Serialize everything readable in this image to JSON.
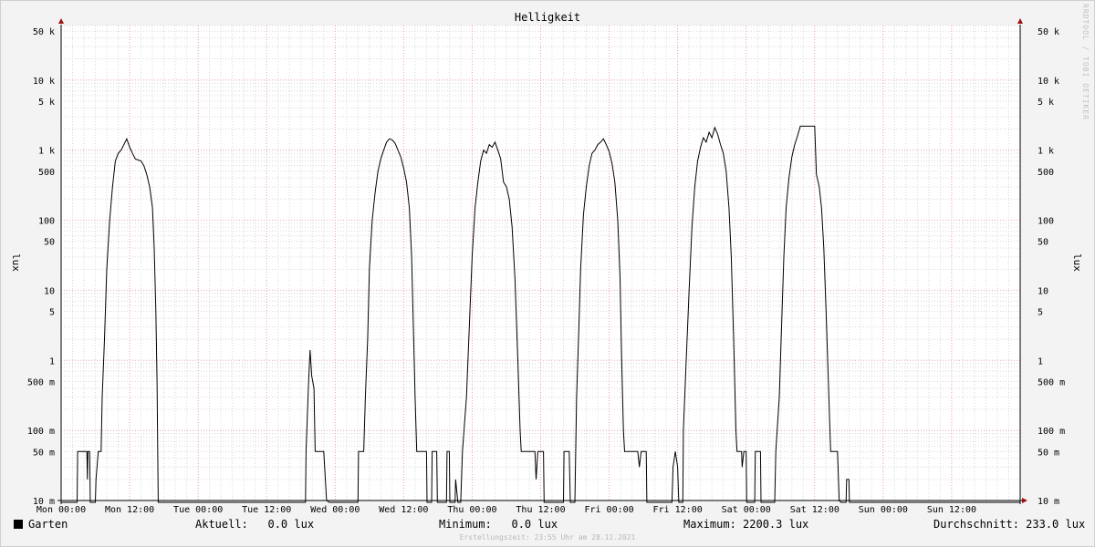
{
  "chart_data": {
    "type": "line",
    "title": "Helligkeit",
    "ylabel_left": "lux",
    "ylabel_right": "lux",
    "yscale": "log",
    "ylim": [
      10,
      60000
    ],
    "x_tick_labels": [
      "Mon 00:00",
      "Mon 12:00",
      "Tue 00:00",
      "Tue 12:00",
      "Wed 00:00",
      "Wed 12:00",
      "Thu 00:00",
      "Thu 12:00",
      "Fri 00:00",
      "Fri 12:00",
      "Sat 00:00",
      "Sat 12:00",
      "Sun 00:00",
      "Sun 12:00"
    ],
    "x_hours_range": [
      0,
      168
    ],
    "y_ticks": [
      {
        "value": 50000,
        "label": "50 k"
      },
      {
        "value": 10000,
        "label": "10 k"
      },
      {
        "value": 5000,
        "label": "5 k"
      },
      {
        "value": 1000,
        "label": "1 k"
      },
      {
        "value": 500,
        "label": "500"
      },
      {
        "value": 100,
        "label": "100"
      },
      {
        "value": 50,
        "label": "50"
      },
      {
        "value": 10,
        "label": "10"
      },
      {
        "value": 5,
        "label": "5"
      },
      {
        "value": 1,
        "label": "1"
      },
      {
        "value": 0.5,
        "label": "500 m"
      },
      {
        "value": 0.1,
        "label": "100 m"
      },
      {
        "value": 0.05,
        "label": "50 m"
      },
      {
        "value": 0.01,
        "label": "10 m"
      }
    ],
    "grid": true,
    "series": [
      {
        "name": "Garten",
        "points": [
          [
            0,
            0.001
          ],
          [
            2.8,
            0.001
          ],
          [
            2.9,
            0.05
          ],
          [
            4.5,
            0.05
          ],
          [
            4.6,
            0.02
          ],
          [
            4.7,
            0.05
          ],
          [
            5.0,
            0.05
          ],
          [
            5.1,
            0.001
          ],
          [
            6.0,
            0.001
          ],
          [
            6.1,
            0.02
          ],
          [
            6.5,
            0.05
          ],
          [
            7.0,
            0.05
          ],
          [
            7.2,
            0.3
          ],
          [
            7.6,
            2
          ],
          [
            8.0,
            20
          ],
          [
            8.5,
            100
          ],
          [
            9.0,
            300
          ],
          [
            9.5,
            700
          ],
          [
            10.0,
            900
          ],
          [
            10.5,
            1000
          ],
          [
            11.0,
            1200
          ],
          [
            11.5,
            1450
          ],
          [
            12.0,
            1100
          ],
          [
            12.5,
            900
          ],
          [
            13.0,
            750
          ],
          [
            14.0,
            700
          ],
          [
            14.5,
            600
          ],
          [
            15.0,
            450
          ],
          [
            15.5,
            300
          ],
          [
            16.0,
            150
          ],
          [
            16.3,
            40
          ],
          [
            16.6,
            5
          ],
          [
            16.8,
            0.5
          ],
          [
            17.0,
            0.001
          ],
          [
            42.8,
            0.001
          ],
          [
            42.9,
            0.05
          ],
          [
            43.3,
            0.4
          ],
          [
            43.6,
            1.4
          ],
          [
            43.9,
            0.6
          ],
          [
            44.3,
            0.4
          ],
          [
            44.5,
            0.05
          ],
          [
            46.0,
            0.05
          ],
          [
            46.5,
            0.01
          ],
          [
            47.0,
            0.001
          ],
          [
            52.0,
            0.001
          ],
          [
            52.1,
            0.05
          ],
          [
            53.0,
            0.05
          ],
          [
            53.3,
            0.3
          ],
          [
            53.7,
            2
          ],
          [
            54.0,
            20
          ],
          [
            54.5,
            100
          ],
          [
            55.0,
            250
          ],
          [
            55.5,
            500
          ],
          [
            56.0,
            750
          ],
          [
            56.5,
            1000
          ],
          [
            57.0,
            1300
          ],
          [
            57.5,
            1450
          ],
          [
            58.0,
            1400
          ],
          [
            58.5,
            1250
          ],
          [
            59.0,
            1000
          ],
          [
            59.5,
            800
          ],
          [
            60.0,
            550
          ],
          [
            60.5,
            350
          ],
          [
            61.0,
            150
          ],
          [
            61.4,
            30
          ],
          [
            61.7,
            3
          ],
          [
            62.0,
            0.3
          ],
          [
            62.3,
            0.05
          ],
          [
            64.0,
            0.05
          ],
          [
            64.1,
            0.001
          ],
          [
            64.9,
            0.001
          ],
          [
            65.0,
            0.05
          ],
          [
            65.8,
            0.05
          ],
          [
            65.9,
            0.001
          ],
          [
            67.5,
            0.001
          ],
          [
            67.6,
            0.05
          ],
          [
            68.0,
            0.05
          ],
          [
            68.1,
            0.001
          ],
          [
            69.0,
            0.001
          ],
          [
            69.1,
            0.02
          ],
          [
            69.5,
            0.001
          ],
          [
            70.0,
            0.001
          ],
          [
            70.3,
            0.05
          ],
          [
            71.0,
            0.3
          ],
          [
            71.5,
            3
          ],
          [
            72.0,
            30
          ],
          [
            72.5,
            150
          ],
          [
            73.0,
            350
          ],
          [
            73.5,
            700
          ],
          [
            74.0,
            1000
          ],
          [
            74.5,
            900
          ],
          [
            75.0,
            1200
          ],
          [
            75.5,
            1100
          ],
          [
            76.0,
            1300
          ],
          [
            76.5,
            1000
          ],
          [
            77.0,
            750
          ],
          [
            77.5,
            350
          ],
          [
            78.0,
            300
          ],
          [
            78.5,
            200
          ],
          [
            79.0,
            80
          ],
          [
            79.5,
            15
          ],
          [
            80.0,
            1
          ],
          [
            80.4,
            0.1
          ],
          [
            80.6,
            0.05
          ],
          [
            83.0,
            0.05
          ],
          [
            83.2,
            0.02
          ],
          [
            83.5,
            0.05
          ],
          [
            84.5,
            0.05
          ],
          [
            84.6,
            0.001
          ],
          [
            88.0,
            0.001
          ],
          [
            88.1,
            0.05
          ],
          [
            89.0,
            0.05
          ],
          [
            89.2,
            0.001
          ],
          [
            90.0,
            0.001
          ],
          [
            90.3,
            0.3
          ],
          [
            90.7,
            3
          ],
          [
            91.0,
            20
          ],
          [
            91.5,
            120
          ],
          [
            92.0,
            300
          ],
          [
            92.5,
            600
          ],
          [
            93.0,
            900
          ],
          [
            93.5,
            1000
          ],
          [
            94.0,
            1200
          ],
          [
            94.5,
            1300
          ],
          [
            95.0,
            1450
          ],
          [
            95.5,
            1200
          ],
          [
            96.0,
            950
          ],
          [
            96.5,
            650
          ],
          [
            97.0,
            350
          ],
          [
            97.5,
            100
          ],
          [
            97.9,
            15
          ],
          [
            98.2,
            1
          ],
          [
            98.5,
            0.1
          ],
          [
            98.7,
            0.05
          ],
          [
            101.0,
            0.05
          ],
          [
            101.3,
            0.03
          ],
          [
            101.6,
            0.05
          ],
          [
            102.5,
            0.05
          ],
          [
            102.6,
            0.001
          ],
          [
            107.0,
            0.001
          ],
          [
            107.2,
            0.03
          ],
          [
            107.6,
            0.05
          ],
          [
            108.0,
            0.03
          ],
          [
            108.2,
            0.001
          ],
          [
            108.9,
            0.001
          ],
          [
            109.0,
            0.1
          ],
          [
            109.5,
            1
          ],
          [
            110.0,
            10
          ],
          [
            110.5,
            80
          ],
          [
            111.0,
            300
          ],
          [
            111.5,
            700
          ],
          [
            112.0,
            1100
          ],
          [
            112.5,
            1500
          ],
          [
            113.0,
            1300
          ],
          [
            113.5,
            1800
          ],
          [
            114.0,
            1500
          ],
          [
            114.5,
            2100
          ],
          [
            115.0,
            1700
          ],
          [
            115.5,
            1200
          ],
          [
            116.0,
            900
          ],
          [
            116.5,
            500
          ],
          [
            117.0,
            150
          ],
          [
            117.4,
            30
          ],
          [
            117.8,
            2
          ],
          [
            118.2,
            0.1
          ],
          [
            118.4,
            0.05
          ],
          [
            119.2,
            0.05
          ],
          [
            119.3,
            0.03
          ],
          [
            119.6,
            0.05
          ],
          [
            120.0,
            0.05
          ],
          [
            120.1,
            0.001
          ],
          [
            121.5,
            0.001
          ],
          [
            121.6,
            0.05
          ],
          [
            122.5,
            0.05
          ],
          [
            122.6,
            0.001
          ],
          [
            125.0,
            0.001
          ],
          [
            125.2,
            0.05
          ],
          [
            125.8,
            0.3
          ],
          [
            126.2,
            3
          ],
          [
            126.6,
            30
          ],
          [
            127.0,
            150
          ],
          [
            127.5,
            400
          ],
          [
            128.0,
            800
          ],
          [
            128.5,
            1200
          ],
          [
            129.0,
            1600
          ],
          [
            129.5,
            2200
          ],
          [
            132.0,
            2200
          ],
          [
            132.3,
            450
          ],
          [
            132.8,
            300
          ],
          [
            133.2,
            150
          ],
          [
            133.6,
            40
          ],
          [
            134.0,
            5
          ],
          [
            134.4,
            0.5
          ],
          [
            134.8,
            0.05
          ],
          [
            136.0,
            0.05
          ],
          [
            136.3,
            0.01
          ],
          [
            136.6,
            0.001
          ],
          [
            137.5,
            0.001
          ],
          [
            137.6,
            0.02
          ],
          [
            138.0,
            0.02
          ],
          [
            138.1,
            0.001
          ],
          [
            168,
            0.001
          ]
        ]
      }
    ]
  },
  "legend": {
    "series_name": "Garten",
    "current": "Aktuell:   0.0 lux",
    "minimum": "Minimum:   0.0 lux",
    "maximum": "Maximum: 2200.3 lux",
    "average": "Durchschnitt: 233.0 lux"
  },
  "footer": "Erstellungszeit: 23:55 Uhr am 28.11.2021",
  "watermark": "RRDTOOL / TOBI OETIKER",
  "colors": {
    "line": "#000000",
    "major_grid": "#e8a0a8",
    "minor_grid": "#d8d8d8",
    "axis": "#000000",
    "arrow": "#9b1010",
    "background": "#f3f3f3"
  }
}
